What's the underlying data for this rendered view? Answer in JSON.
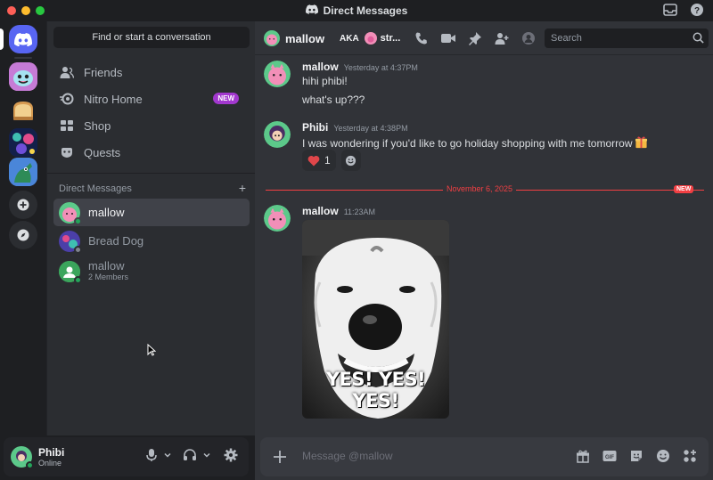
{
  "window": {
    "title": "Direct Messages"
  },
  "sidebar": {
    "find_button": "Find or start a conversation",
    "nav": [
      {
        "label": "Friends",
        "icon": "friends-icon"
      },
      {
        "label": "Nitro Home",
        "icon": "nitro-icon",
        "badge": "NEW"
      },
      {
        "label": "Shop",
        "icon": "shop-icon"
      },
      {
        "label": "Quests",
        "icon": "quests-icon"
      }
    ],
    "dm_header": "Direct Messages",
    "dm_add": "+",
    "dms": [
      {
        "name": "mallow",
        "sub": "",
        "status": "online",
        "active": true
      },
      {
        "name": "Bread Dog",
        "sub": "",
        "status": "offline",
        "active": false
      },
      {
        "name": "mallow",
        "sub": "2 Members",
        "status": "group",
        "active": false
      }
    ]
  },
  "user_panel": {
    "name": "Phibi",
    "status": "Online"
  },
  "chat_header": {
    "name": "mallow",
    "aka_label": "AKA",
    "aka_name": "str...",
    "search_placeholder": "Search"
  },
  "messages": [
    {
      "author": "mallow",
      "time": "Yesterday at 4:37PM",
      "lines": [
        "hihi phibi!",
        "what's up???"
      ]
    },
    {
      "author": "Phibi",
      "time": "Yesterday at 4:38PM",
      "lines": [
        "I was wondering if you'd like to go holiday shopping with me tomorrow"
      ],
      "reaction": {
        "emoji": "heart",
        "count": "1"
      }
    },
    {
      "author": "mallow",
      "time": "11:23AM",
      "gif_caption": "YES! YES! YES!"
    }
  ],
  "divider": {
    "label": "November 6, 2025",
    "badge": "NEW"
  },
  "composer": {
    "placeholder": "Message @mallow"
  },
  "colors": {
    "blurple": "#5865f2",
    "online": "#23a55a",
    "danger": "#f23f43",
    "nitro": "#a238ce"
  }
}
